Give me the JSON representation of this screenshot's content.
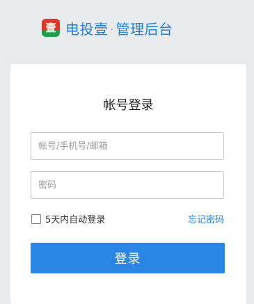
{
  "brand": {
    "logo_char": "壹",
    "name": "电投壹",
    "separator": "·",
    "subtitle": "管理后台"
  },
  "login": {
    "title": "帐号登录",
    "username_placeholder": "帐号/手机号/邮箱",
    "password_placeholder": "密码",
    "remember_label": "5天内自动登录",
    "forgot_label": "忘记密码",
    "submit_label": "登录"
  },
  "colors": {
    "accent": "#2b85e4",
    "link": "#1f7fd6",
    "background": "#e9eaec"
  }
}
